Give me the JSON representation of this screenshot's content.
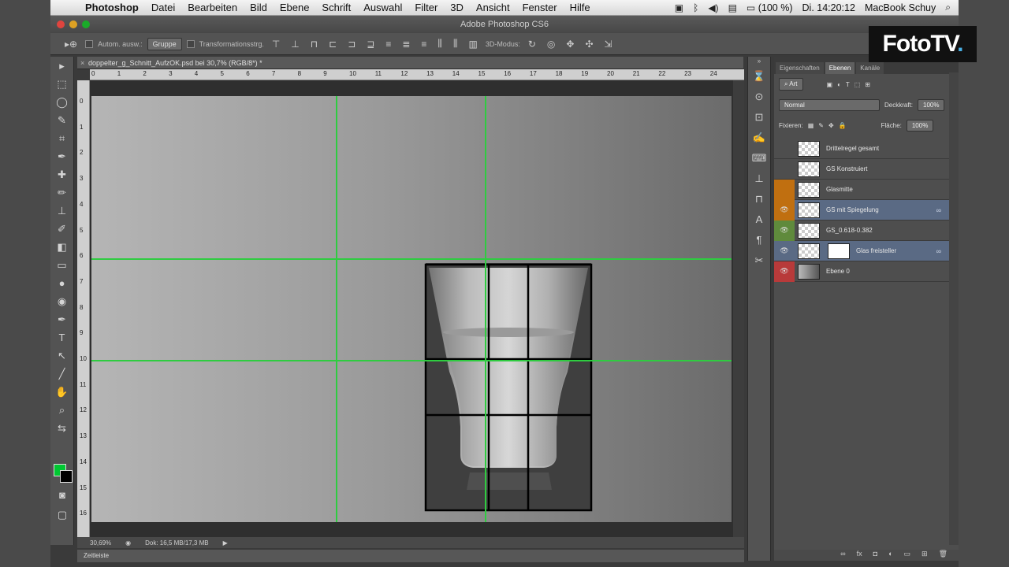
{
  "menubar": {
    "app": "Photoshop",
    "items": [
      "Datei",
      "Bearbeiten",
      "Bild",
      "Ebene",
      "Schrift",
      "Auswahl",
      "Filter",
      "3D",
      "Ansicht",
      "Fenster",
      "Hilfe"
    ],
    "battery": "(100 %)",
    "clock": "Di. 14:20:12",
    "user": "MacBook Schuy"
  },
  "window": {
    "title": "Adobe Photoshop CS6"
  },
  "options": {
    "auto_select": "Autom. ausw.:",
    "auto_select_value": "Gruppe",
    "transform": "Transformationsstrg.",
    "mode3d": "3D-Modus:"
  },
  "document": {
    "tab": "doppelter_g_Schnitt_AufzOK.psd bei 30,7% (RGB/8*) *",
    "zoom": "30,69%",
    "doc_info": "Dok: 16,5 MB/17,3 MB",
    "timeline": "Zeitleiste"
  },
  "rulers": {
    "top": [
      "0",
      "1",
      "2",
      "3",
      "4",
      "5",
      "6",
      "7",
      "8",
      "9",
      "10",
      "11",
      "12",
      "13",
      "14",
      "15",
      "16",
      "17",
      "18",
      "19",
      "20",
      "21",
      "22",
      "23",
      "24"
    ],
    "left": [
      "0",
      "1",
      "2",
      "3",
      "4",
      "5",
      "6",
      "7",
      "8",
      "9",
      "10",
      "11",
      "12",
      "13",
      "14",
      "15",
      "16"
    ]
  },
  "panel": {
    "tabs": [
      "Eigenschaften",
      "Ebenen",
      "Kanäle"
    ],
    "filter_kind": "Art",
    "blend_mode": "Normal",
    "opacity_label": "Deckkraft:",
    "opacity_value": "100%",
    "lock_label": "Fixieren:",
    "fill_label": "Fläche:",
    "fill_value": "100%",
    "layers": [
      {
        "name": "Drittelregel gesamt",
        "eye": false,
        "color": "",
        "selected": false
      },
      {
        "name": "GS Konstruiert",
        "eye": false,
        "color": "",
        "selected": false
      },
      {
        "name": "Glasmitte",
        "eye": false,
        "color": "#c06f10",
        "selected": false
      },
      {
        "name": "GS mit Spiegelung",
        "eye": true,
        "color": "#c06f10",
        "selected": true
      },
      {
        "name": "GS_0.618-0.382",
        "eye": true,
        "color": "#5f8a3c",
        "selected": false
      },
      {
        "name": "Glas freisteller",
        "eye": true,
        "color": "",
        "selected": true
      },
      {
        "name": "Ebene 0",
        "eye": true,
        "color": "#b83a3a",
        "selected": false
      }
    ]
  },
  "brand": {
    "logo": "FotoTV",
    "logo_dot": "."
  },
  "colors": {
    "foreground": "#00c832",
    "background": "#000000",
    "guide": "#2ecc40"
  }
}
